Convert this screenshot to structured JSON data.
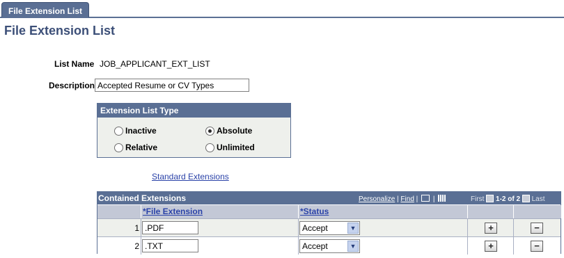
{
  "tab": {
    "label": "File Extension List"
  },
  "page_title": "File Extension List",
  "form": {
    "list_name_label": "List Name",
    "list_name_value": "JOB_APPLICANT_EXT_LIST",
    "description_label": "Description",
    "description_value": "Accepted Resume or CV Types"
  },
  "ext_list_type": {
    "header": "Extension List Type",
    "options": [
      {
        "label": "Inactive",
        "selected": false
      },
      {
        "label": "Absolute",
        "selected": true
      },
      {
        "label": "Relative",
        "selected": false
      },
      {
        "label": "Unlimited",
        "selected": false
      }
    ]
  },
  "standard_extensions_link": "Standard Extensions",
  "grid": {
    "title": "Contained Extensions",
    "personalize": "Personalize",
    "sep1": " | ",
    "find": "Find",
    "sep2": " | ",
    "first": "First",
    "range": "1-2 of 2",
    "last": "Last",
    "columns": [
      "*File Extension",
      "*Status"
    ],
    "rows": [
      {
        "num": "1",
        "extension": ".PDF",
        "status": "Accept"
      },
      {
        "num": "2",
        "extension": ".TXT",
        "status": "Accept"
      }
    ]
  },
  "colors": {
    "accent": "#5a6f94",
    "title": "#3c4f78",
    "link": "#2a42a8",
    "panel": "#eef0ec"
  }
}
